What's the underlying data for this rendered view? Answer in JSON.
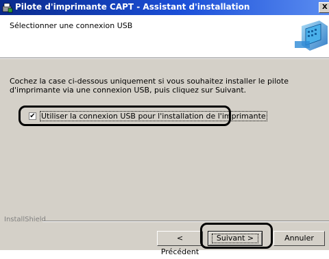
{
  "window": {
    "title": "Pilote d'imprimante CAPT - Assistant d'installation",
    "close_glyph": "X"
  },
  "header": {
    "title": "Sélectionner une connexion USB",
    "graphic": "computer-installer-graphic"
  },
  "body": {
    "instruction": "Cochez la case ci-dessous uniquement si vous souhaitez installer le pilote d'imprimante via une connexion USB, puis cliquez sur Suivant.",
    "checkbox": {
      "label": "Utiliser la connexion USB pour l'installation de l'imprimante",
      "checked": true,
      "check_glyph": "✔"
    }
  },
  "footer": {
    "brand": "InstallShield",
    "prev_label": "< Précédent",
    "next_label": "Suivant >",
    "cancel_label": "Annuler"
  },
  "colors": {
    "titlebar": "#0a2a8c",
    "dialog_bg": "#d4d0c8"
  }
}
